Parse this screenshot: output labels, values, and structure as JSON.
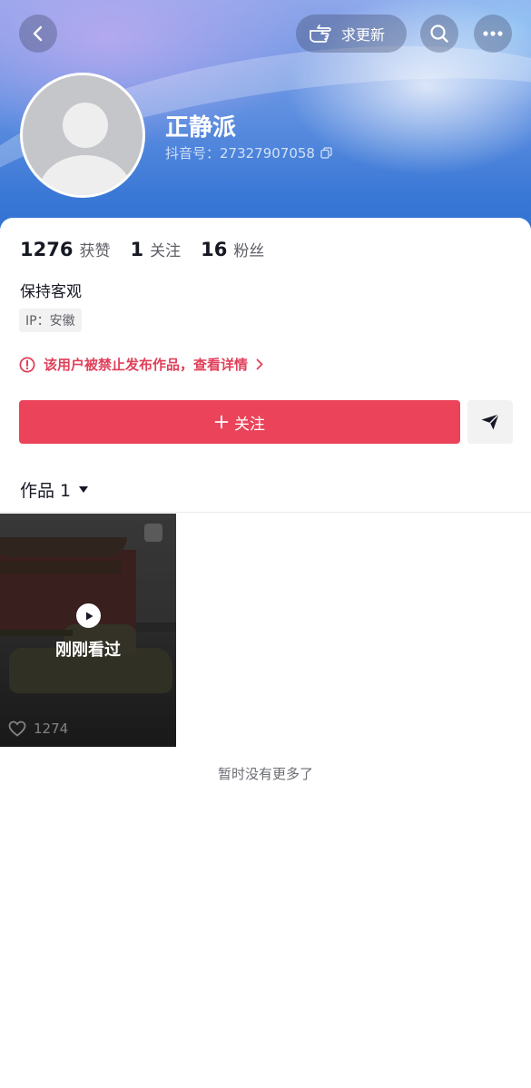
{
  "header": {
    "request_update_label": "求更新",
    "nickname": "正静派",
    "douyin_id": "抖音号：27327907058"
  },
  "stats": [
    {
      "value": "1276",
      "label": "获赞"
    },
    {
      "value": "1",
      "label": "关注"
    },
    {
      "value": "16",
      "label": "粉丝"
    }
  ],
  "profile": {
    "bio": "保持客观",
    "ip_location": "IP：安徽",
    "ban_notice": "该用户被禁止发布作品，查看详情"
  },
  "actions": {
    "follow_label": "关注",
    "follow_color": "#ea435a"
  },
  "works": {
    "tab_label": "作品 1",
    "items": [
      {
        "overlay_label": "刚刚看过",
        "likes": "1274"
      }
    ],
    "end_text": "暂时没有更多了"
  },
  "icons": {
    "back": "back-icon",
    "search": "search-icon",
    "more": "more-icon",
    "request_update": "pointing-hand-icon",
    "copy": "copy-icon",
    "warning": "warning-icon",
    "share": "send-icon",
    "play": "play-icon",
    "like": "heart-icon"
  }
}
